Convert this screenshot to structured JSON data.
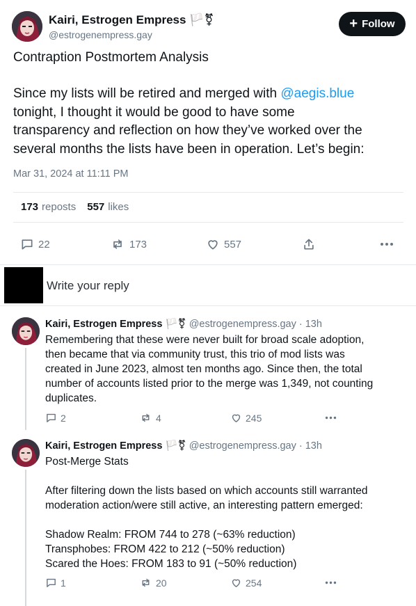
{
  "post": {
    "author": {
      "name": "Kairi, Estrogen Empress",
      "flags": "🏳️⚧",
      "handle": "@estrogenempress.gay"
    },
    "follow_label": "Follow",
    "title": "Contraption Postmortem Analysis",
    "body_before_mention": "Since my lists will be retired and merged with ",
    "mention": "@aegis.blue",
    "body_after_mention": "\ntonight, I thought it would be good to have some\ntransparency and reflection on how they’ve worked over the\nseveral months the lists have been in operation. Let’s begin:",
    "timestamp": "Mar 31, 2024 at 11:11 PM",
    "reposts_count": "173",
    "reposts_label": "reposts",
    "likes_count": "557",
    "likes_label": "likes",
    "actions": {
      "replies": "22",
      "reposts": "173",
      "likes": "557"
    }
  },
  "composer": {
    "placeholder": "Write your reply"
  },
  "replies": [
    {
      "name": "Kairi, Estrogen Empress",
      "flags": "🏳️⚧",
      "handle": "@estrogenempress.gay",
      "time": "· 13h",
      "text": "Remembering that these were never built for broad scale adoption,\nthen became that via community trust, this trio of mod lists was\ncreated in June 2023, almost ten months ago. Since then, the total\nnumber of accounts listed prior to the merge was 1,349, not counting\nduplicates.",
      "replies": "2",
      "reposts": "4",
      "likes": "245"
    },
    {
      "name": "Kairi, Estrogen Empress",
      "flags": "🏳️⚧",
      "handle": "@estrogenempress.gay",
      "time": "· 13h",
      "text": "Post-Merge Stats\n\nAfter filtering down the lists based on which accounts still warranted\nmoderation action/were still active, an interesting pattern emerged:\n\nShadow Realm: FROM 744 to 278 (~63% reduction)\nTransphobes: FROM 422 to 212 (~50% reduction)\nScared the Hoes: FROM 183 to 91 (~50% reduction)",
      "replies": "1",
      "reposts": "20",
      "likes": "254"
    }
  ],
  "colors": {
    "accent": "#1d9bf0",
    "text": "#0f1419",
    "muted": "#687684",
    "divider": "#e6e9ec",
    "button": "#0f1419"
  }
}
